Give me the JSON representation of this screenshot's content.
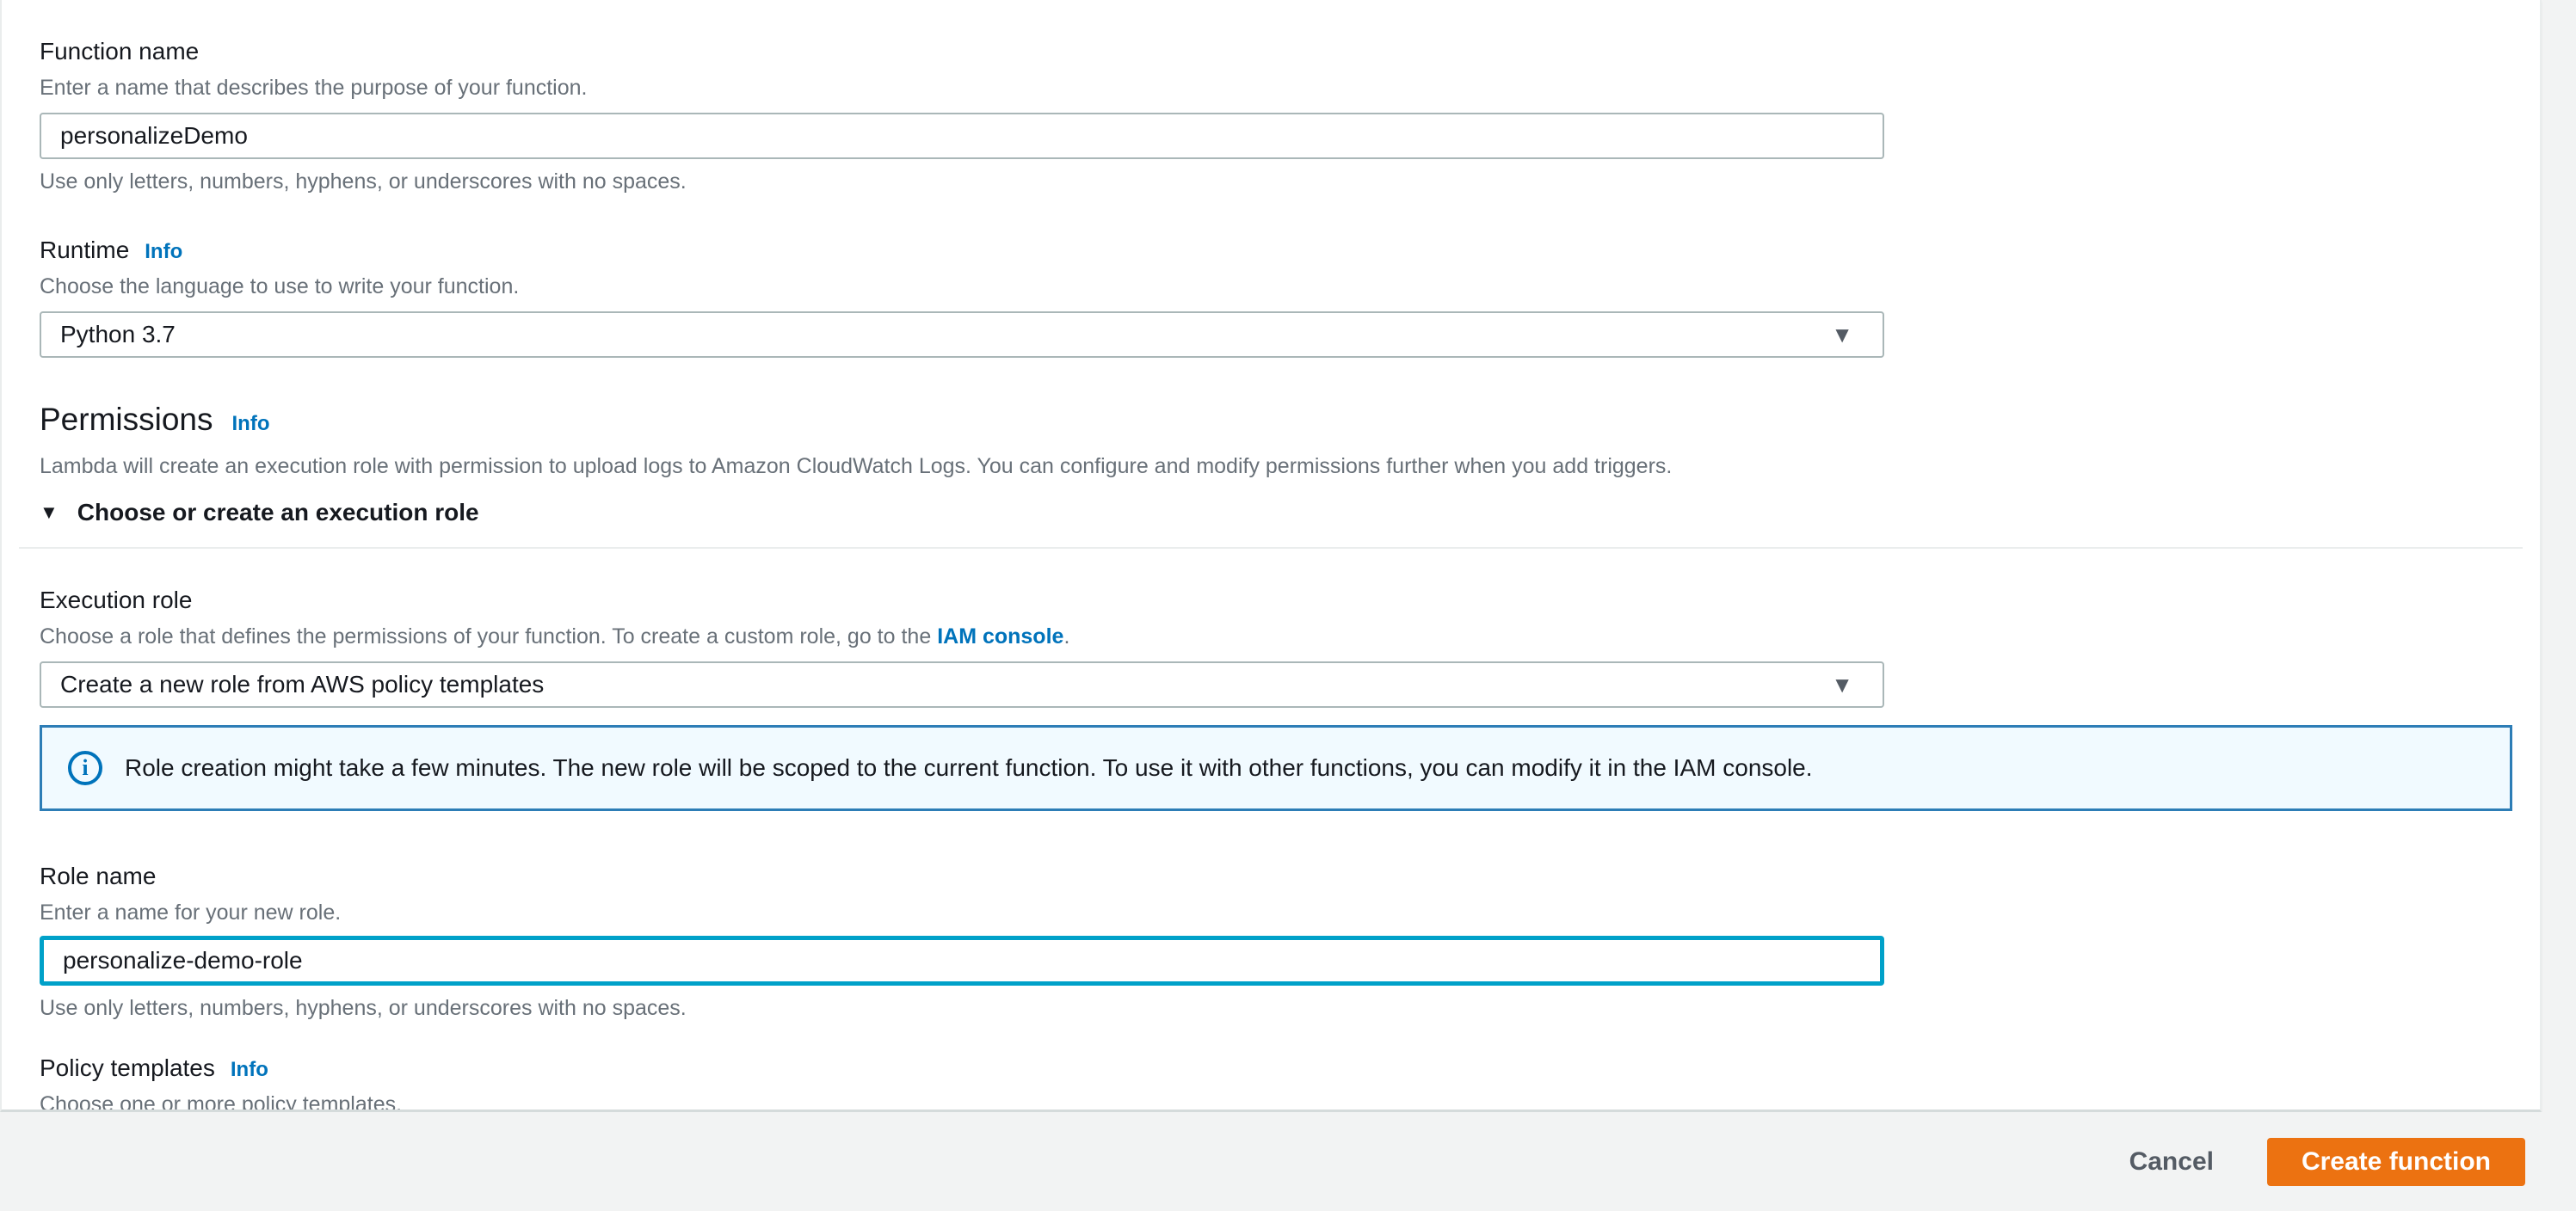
{
  "colors": {
    "accent_orange": "#ec7211",
    "link_blue": "#0073bb",
    "focus_blue": "#00a1c9",
    "alert_border": "#2d7db6",
    "alert_bg": "#f1faff",
    "input_border": "#aab7b8",
    "page_bg": "#f2f3f3"
  },
  "icons": {
    "dropdown_arrow": "▼",
    "expander_open": "▼",
    "info_glyph": "i"
  },
  "form": {
    "function_name": {
      "label": "Function name",
      "description": "Enter a name that describes the purpose of your function.",
      "value": "personalizeDemo",
      "constraint": "Use only letters, numbers, hyphens, or underscores with no spaces."
    },
    "runtime": {
      "label": "Runtime",
      "info_label": "Info",
      "description": "Choose the language to use to write your function.",
      "value": "Python 3.7"
    },
    "permissions": {
      "title": "Permissions",
      "info_label": "Info",
      "description": "Lambda will create an execution role with permission to upload logs to Amazon CloudWatch Logs. You can configure and modify permissions further when you add triggers.",
      "expander_label": "Choose or create an execution role"
    },
    "execution_role": {
      "label": "Execution role",
      "description_prefix": "Choose a role that defines the permissions of your function. To create a custom role, go to the ",
      "link_text": "IAM console",
      "description_suffix": ".",
      "value": "Create a new role from AWS policy templates"
    },
    "alert": {
      "text": "Role creation might take a few minutes. The new role will be scoped to the current function. To use it with other functions, you can modify it in the IAM console."
    },
    "role_name": {
      "label": "Role name",
      "description": "Enter a name for your new role.",
      "value": "personalize-demo-role",
      "constraint": "Use only letters, numbers, hyphens, or underscores with no spaces."
    },
    "policy_templates": {
      "label": "Policy templates",
      "info_label": "Info",
      "description": "Choose one or more policy templates.",
      "value": ""
    }
  },
  "footer": {
    "cancel_label": "Cancel",
    "create_label": "Create function"
  }
}
